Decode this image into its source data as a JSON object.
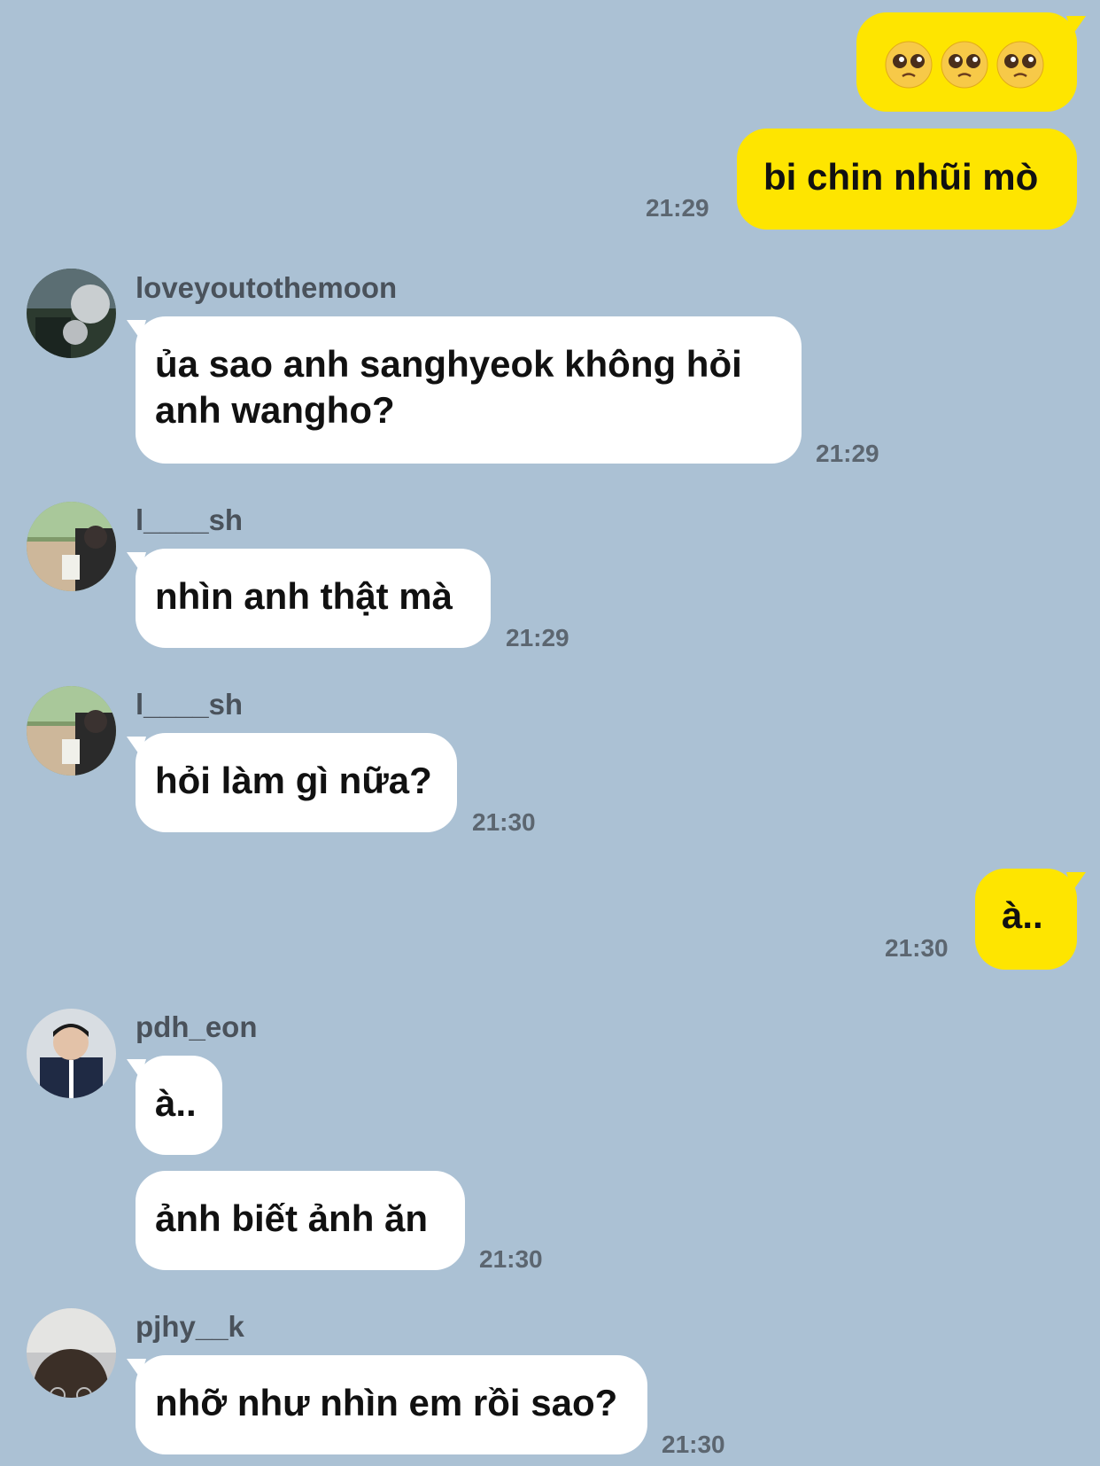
{
  "messages": [
    {
      "side": "me",
      "emojis": [
        "pleading-face",
        "pleading-face",
        "pleading-face"
      ]
    },
    {
      "side": "me",
      "text": "bi chin nhũi mò",
      "time": "21:29"
    },
    {
      "side": "other",
      "sender": "loveyoutothemoon",
      "text": "ủa sao anh sanghyeok không hỏi\nanh wangho?",
      "time": "21:29"
    },
    {
      "side": "other",
      "sender": "l____sh",
      "text": "nhìn anh thật mà",
      "time": "21:29"
    },
    {
      "side": "other",
      "sender": "l____sh",
      "text": "hỏi làm gì nữa?",
      "time": "21:30"
    },
    {
      "side": "me",
      "text": "à..",
      "time": "21:30"
    },
    {
      "side": "other",
      "sender": "pdh_eon",
      "text": "à.."
    },
    {
      "side": "other",
      "text": "ảnh biết ảnh ăn",
      "time": "21:30"
    },
    {
      "side": "other",
      "sender": "pjhy__k",
      "text": "nhỡ như nhìn em rồi sao?",
      "time": "21:30"
    }
  ],
  "colors": {
    "background": "#abc1d4",
    "my_bubble": "#fee500",
    "other_bubble": "#ffffff"
  }
}
